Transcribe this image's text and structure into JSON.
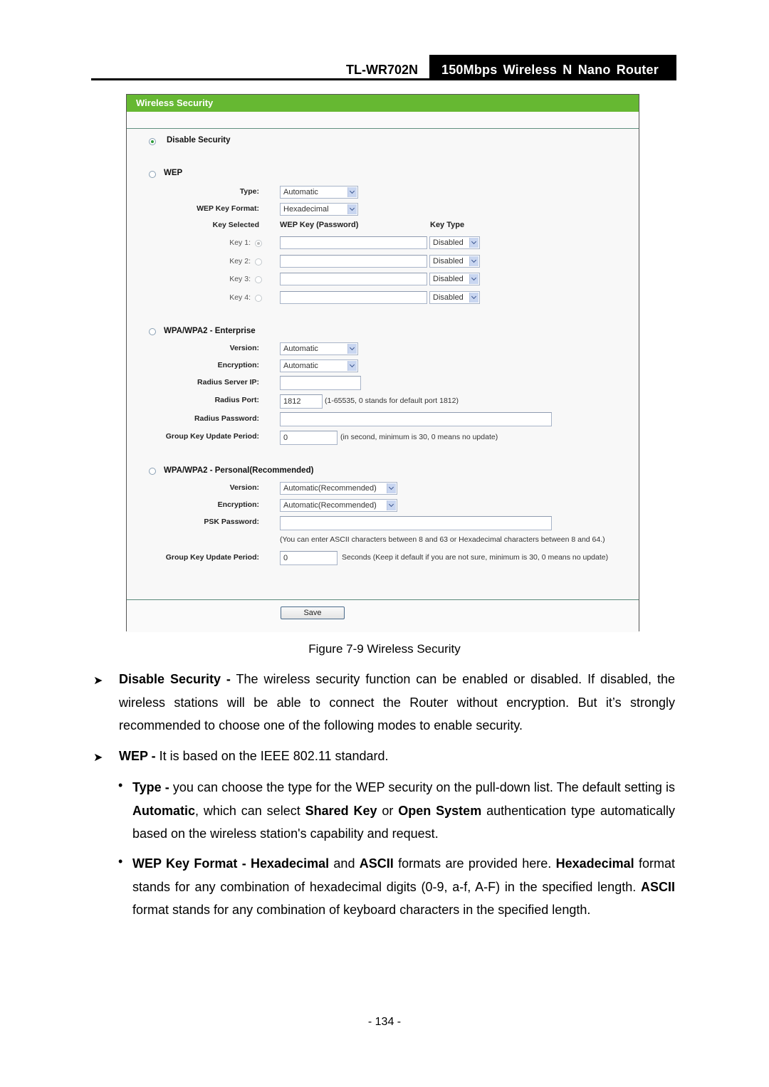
{
  "header": {
    "model": "TL-WR702N",
    "product": "150Mbps Wireless N Nano Router"
  },
  "panel": {
    "title": "Wireless Security",
    "accent_color": "#66b832",
    "disable_security": {
      "label": "Disable Security",
      "selected": true
    },
    "wep": {
      "label": "WEP",
      "selected": false,
      "type_label": "Type:",
      "type_value": "Automatic",
      "format_label": "WEP Key Format:",
      "format_value": "Hexadecimal",
      "key_selected_label": "Key Selected",
      "key_col_label": "WEP Key (Password)",
      "key_type_col_label": "Key Type",
      "keys": [
        {
          "label": "Key 1:",
          "selected": true,
          "value": "",
          "type": "Disabled"
        },
        {
          "label": "Key 2:",
          "selected": false,
          "value": "",
          "type": "Disabled"
        },
        {
          "label": "Key 3:",
          "selected": false,
          "value": "",
          "type": "Disabled"
        },
        {
          "label": "Key 4:",
          "selected": false,
          "value": "",
          "type": "Disabled"
        }
      ]
    },
    "enterprise": {
      "label": "WPA/WPA2 - Enterprise",
      "selected": false,
      "version_label": "Version:",
      "version_value": "Automatic",
      "encryption_label": "Encryption:",
      "encryption_value": "Automatic",
      "radius_ip_label": "Radius Server IP:",
      "radius_ip_value": "",
      "radius_port_label": "Radius Port:",
      "radius_port_value": "1812",
      "radius_port_hint": "(1-65535, 0 stands for default port 1812)",
      "radius_password_label": "Radius Password:",
      "radius_password_value": "",
      "group_key_label": "Group Key Update Period:",
      "group_key_value": "0",
      "group_key_hint": "(in second, minimum is 30, 0 means no update)"
    },
    "personal": {
      "label": "WPA/WPA2 - Personal(Recommended)",
      "selected": false,
      "version_label": "Version:",
      "version_value": "Automatic(Recommended)",
      "encryption_label": "Encryption:",
      "encryption_value": "Automatic(Recommended)",
      "psk_label": "PSK Password:",
      "psk_value": "",
      "psk_hint": "(You can enter ASCII characters between 8 and 63 or Hexadecimal characters between 8 and 64.)",
      "group_key_label": "Group Key Update Period:",
      "group_key_value": "0",
      "group_key_hint": "Seconds (Keep it default if you are not sure, minimum is 30, 0 means no update)"
    },
    "save_label": "Save"
  },
  "caption": "Figure 7-9 Wireless Security",
  "body": {
    "p1_bold": "Disable Security -",
    "p1_text": " The wireless security function can be enabled or disabled. If disabled, the wireless stations will be able to connect the Router without encryption. But it’s strongly recommended to choose one of the following modes to enable security.",
    "p2_bold": "WEP -",
    "p2_text": " It is based on the IEEE 802.11 standard.",
    "b1_bold": "Type -",
    "b1_t1": " you can choose the type for the WEP security on the pull-down list. The default setting is ",
    "b1_b2": "Automatic",
    "b1_t2": ", which can select ",
    "b1_b3": "Shared Key",
    "b1_t3": " or ",
    "b1_b4": "Open System",
    "b1_t4": " authentication type automatically based on the wireless station's capability and request.",
    "b2_bold": "WEP Key Format - Hexadecimal",
    "b2_t1": " and ",
    "b2_b2": "ASCII",
    "b2_t2": " formats are provided here. ",
    "b2_b3": "Hexadecimal",
    "b2_t3": " format stands for any combination of hexadecimal digits (0-9, a-f, A-F) in the specified length. ",
    "b2_b4": "ASCII",
    "b2_t4": " format stands for any combination of keyboard characters in the specified length."
  },
  "page_number": "- 134 -"
}
